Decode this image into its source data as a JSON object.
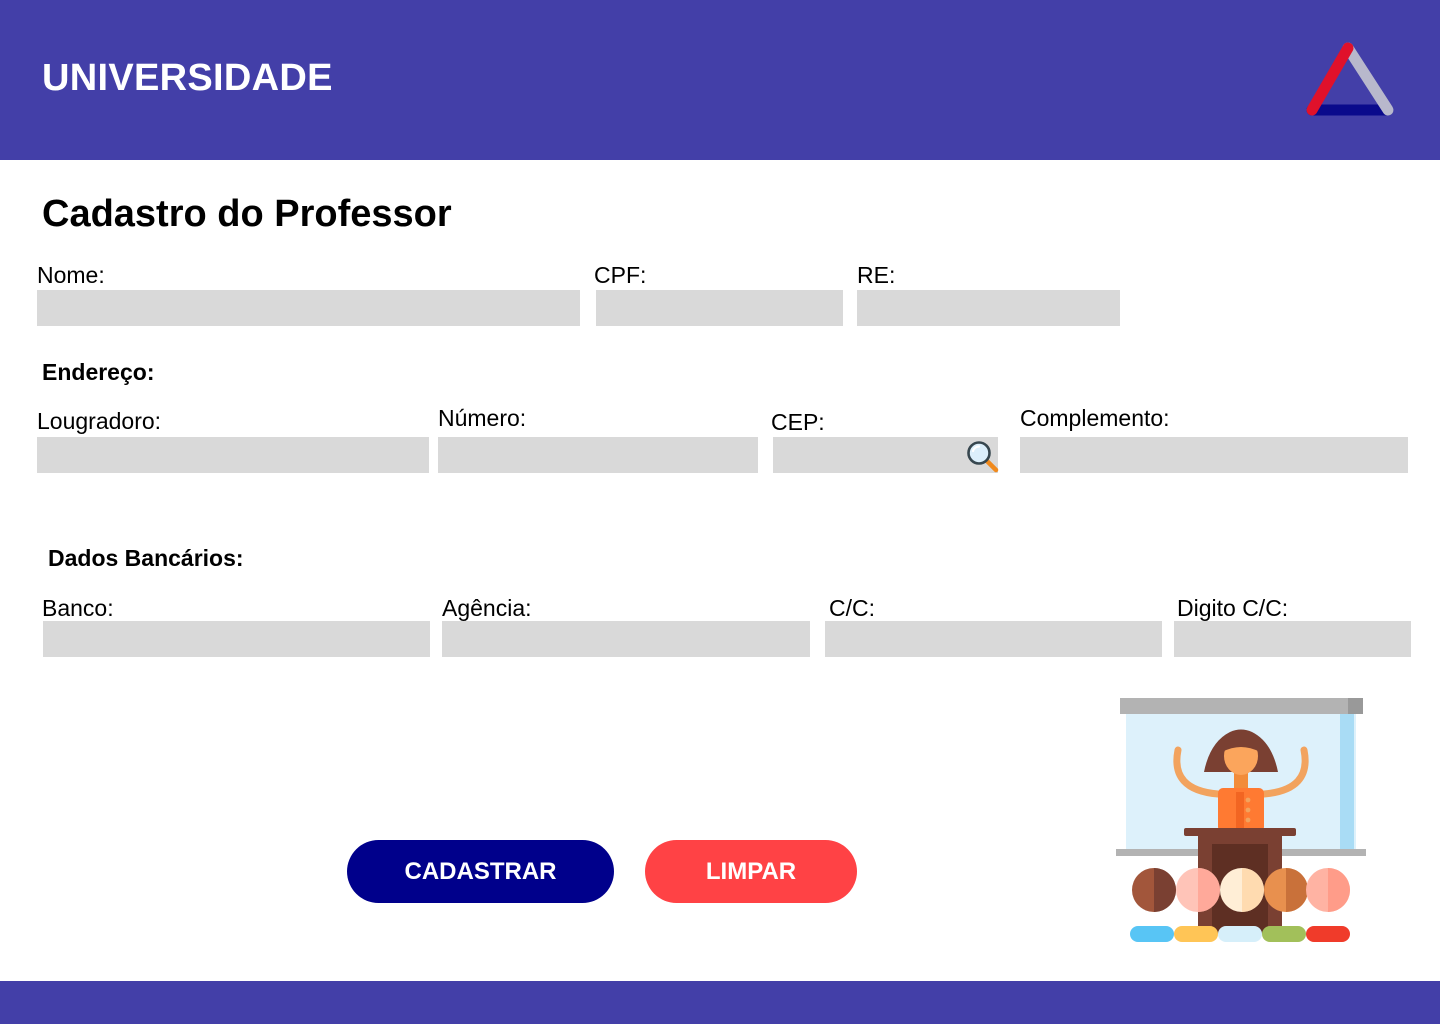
{
  "header": {
    "title": "UNIVERSIDADE"
  },
  "page": {
    "title": "Cadastro do Professor"
  },
  "personal": {
    "nome_label": "Nome:",
    "nome_value": "",
    "cpf_label": "CPF:",
    "cpf_value": "",
    "re_label": "RE:",
    "re_value": ""
  },
  "address": {
    "section_title": "Endereço:",
    "logradouro_label": "Lougradoro:",
    "logradouro_value": "",
    "numero_label": "Número:",
    "numero_value": "",
    "cep_label": "CEP:",
    "cep_value": "",
    "complemento_label": "Complemento:",
    "complemento_value": ""
  },
  "bank": {
    "section_title": "Dados Bancários:",
    "banco_label": "Banco:",
    "banco_value": "",
    "agencia_label": "Agência:",
    "agencia_value": "",
    "cc_label": "C/C:",
    "cc_value": "",
    "digito_label": "Digito C/C:",
    "digito_value": ""
  },
  "actions": {
    "submit_label": "CADASTRAR",
    "clear_label": "LIMPAR"
  },
  "icons": {
    "logo": "triangle-logo-icon",
    "cep_search": "magnifier-icon",
    "illustration": "teacher-lecture-illustration"
  },
  "colors": {
    "header": "#433FA8",
    "field": "#D9D9D9",
    "primary": "#00008B",
    "danger": "#FF4245"
  }
}
